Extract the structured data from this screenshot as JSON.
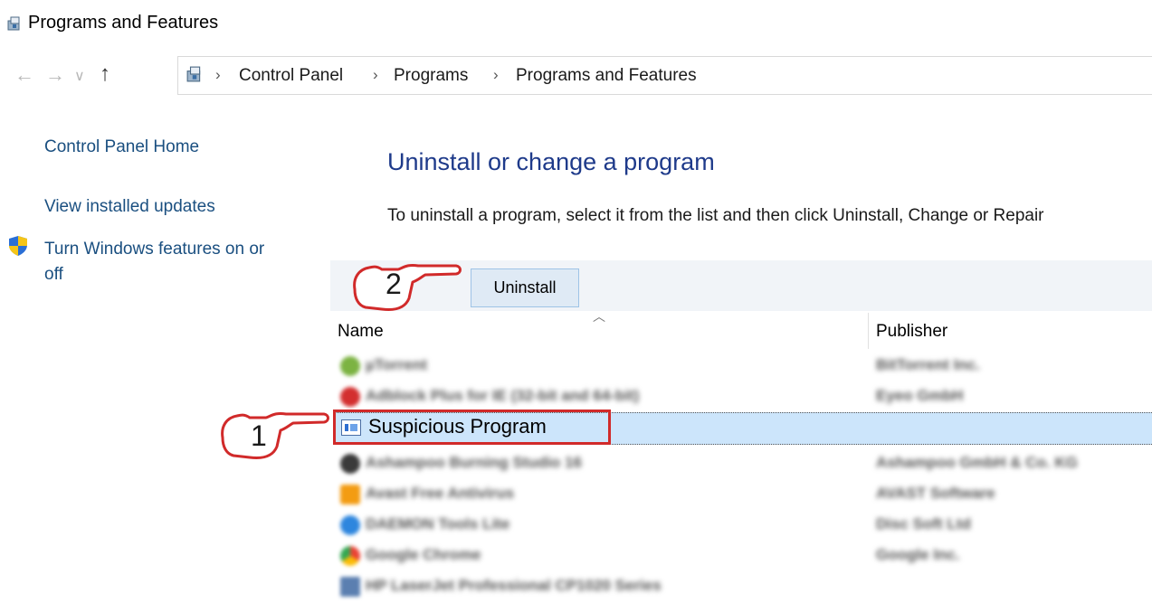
{
  "window": {
    "title": "Programs and Features"
  },
  "navigation": {
    "breadcrumbs": [
      "Control Panel",
      "Programs",
      "Programs and Features"
    ]
  },
  "left_pane": {
    "links": [
      "Control Panel Home",
      "View installed updates",
      "Turn Windows features on or",
      "off"
    ]
  },
  "main": {
    "heading": "Uninstall or change a program",
    "instructions": "To uninstall a program, select it from the list and then click Uninstall, Change or Repair",
    "uninstall_label": "Uninstall",
    "columns": {
      "name": "Name",
      "publisher": "Publisher"
    },
    "rows": [
      {
        "name": "µTorrent",
        "publisher": "BitTorrent Inc."
      },
      {
        "name": "Adblock Plus for IE (32-bit and 64-bit)",
        "publisher": "Eyeo GmbH"
      },
      {
        "name": "Suspicious Program",
        "publisher": ""
      },
      {
        "name": "Ashampoo Burning Studio 16",
        "publisher": "Ashampoo GmbH & Co. KG"
      },
      {
        "name": "Avast Free Antivirus",
        "publisher": "AVAST Software"
      },
      {
        "name": "DAEMON Tools Lite",
        "publisher": "Disc Soft Ltd"
      },
      {
        "name": "Google Chrome",
        "publisher": "Google Inc."
      },
      {
        "name": "HP LaserJet Professional CP1020 Series",
        "publisher": ""
      }
    ]
  },
  "annotations": {
    "step1": "1",
    "step2": "2",
    "color": "#d12a2a"
  },
  "colors": {
    "selection": "#cce5fb",
    "link": "#1a4f80",
    "heading": "#1e3a8a"
  }
}
